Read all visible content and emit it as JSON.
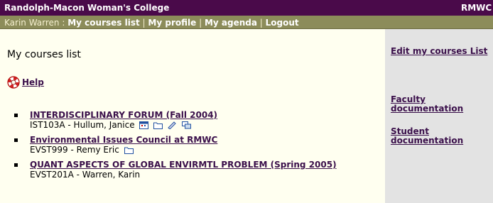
{
  "header": {
    "org": "Randolph-Macon Woman's College",
    "right": "RMWC"
  },
  "nav": {
    "user": "Karin Warren",
    "separator": ":",
    "divider": "|",
    "links": [
      "My courses list",
      "My profile",
      "My agenda",
      "Logout"
    ]
  },
  "main": {
    "title": "My courses list",
    "help": "Help",
    "courses": [
      {
        "name": "INTERDISCIPLINARY FORUM (Fall 2004)",
        "meta": "IST103A - Hullum, Janice",
        "icons": [
          "calendar-icon",
          "folder-icon",
          "forum-icon",
          "chat-icon"
        ]
      },
      {
        "name": "Environmental Issues Council at RMWC",
        "meta": "EVST999 - Remy Eric",
        "icons": [
          "folder-icon"
        ]
      },
      {
        "name": "QUANT ASPECTS OF GLOBAL ENVIRMTL PROBLEM (Spring 2005)",
        "meta": "EVST201A - Warren, Karin",
        "icons": []
      }
    ]
  },
  "side": {
    "edit": "Edit my courses List",
    "faculty": "Faculty documentation",
    "student": "Student documentation"
  },
  "colors": {
    "header_bg": "#4a0a4a",
    "nav_bg": "#8c8c5a",
    "link": "#3a0f4a",
    "side_bg": "#e3e3e3"
  }
}
